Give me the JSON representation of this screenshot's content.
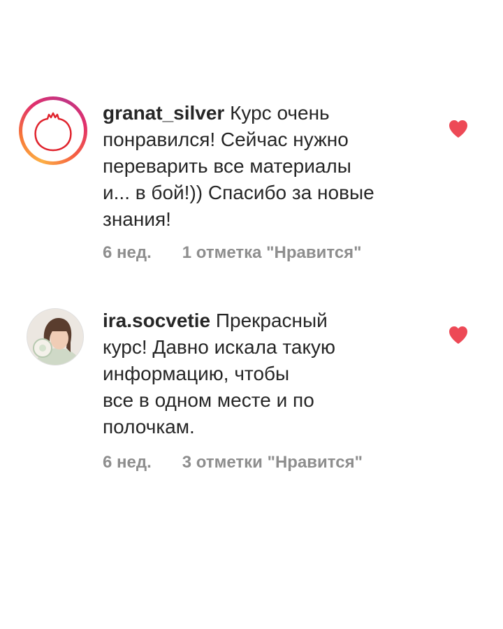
{
  "comments": [
    {
      "username": "granat_silver",
      "text": "Курс очень\nпонравился! Сейчас  нужно\nпереварить все материалы\nи... в бой!)) Спасибо за новые\nзнания!",
      "time": "6 нед.",
      "likes_label": "1 отметка \"Нравится\"",
      "liked": true,
      "avatar": "pomegranate-logo-icon"
    },
    {
      "username": "ira.socvetie",
      "text": "Прекрасный\nкурс! Давно искала такую\nинформацию, чтобы\nвсе в одном месте и по\nполочкам.",
      "time": "6 нед.",
      "likes_label": "3 отметки \"Нравится\"",
      "liked": true,
      "avatar": "profile-photo"
    }
  ],
  "colors": {
    "heart": "#ed4956",
    "meta": "#8e8e8e",
    "text": "#262626",
    "pomegranate": "#e0242e"
  }
}
